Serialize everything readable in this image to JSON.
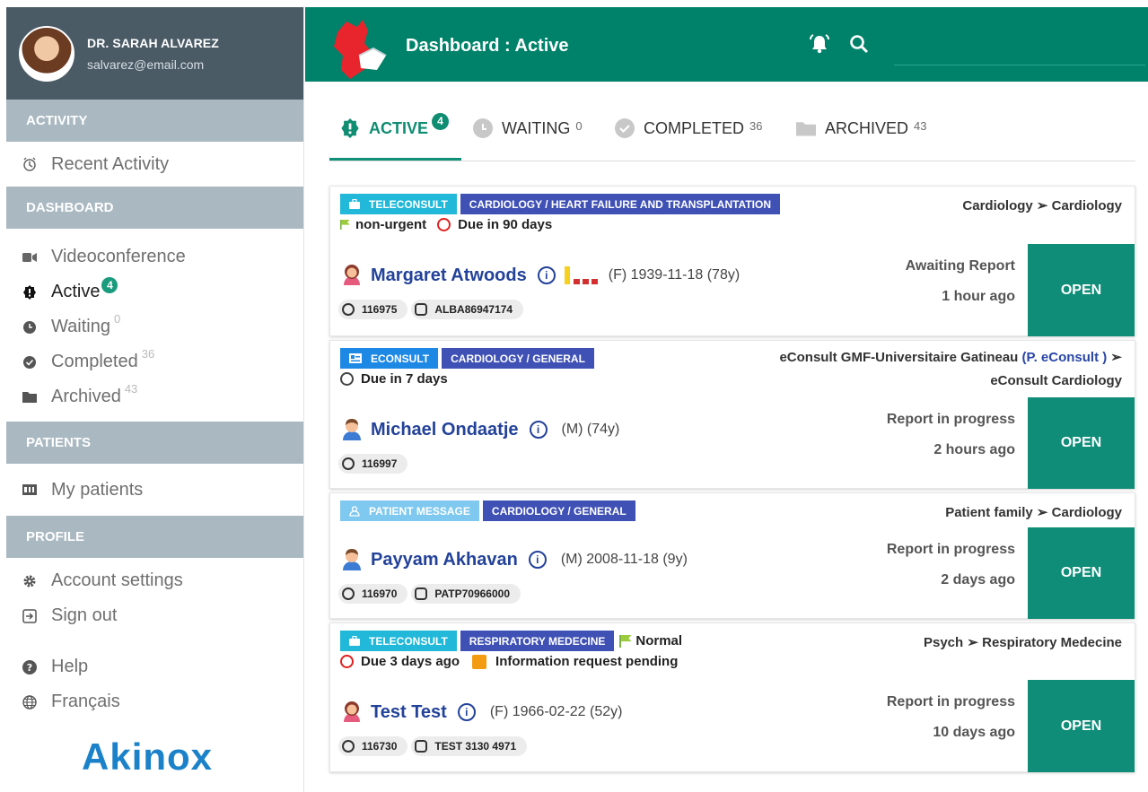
{
  "user": {
    "name": "DR. SARAH ALVAREZ",
    "email": "salvarez@email.com"
  },
  "sidebar": {
    "sections": [
      {
        "title": "ACTIVITY",
        "items": [
          {
            "label": "Recent Activity",
            "icon": "clock-icon"
          }
        ]
      },
      {
        "title": "DASHBOARD",
        "items": [
          {
            "label": "Videoconference",
            "icon": "video-camera-icon"
          },
          {
            "label": "Active",
            "icon": "alert-badge-icon",
            "count": "4"
          },
          {
            "label": "Waiting",
            "icon": "clock-solid-icon",
            "count": "0"
          },
          {
            "label": "Completed",
            "icon": "check-circle-icon",
            "count": "36"
          },
          {
            "label": "Archived",
            "icon": "folder-icon",
            "count": "43"
          }
        ]
      },
      {
        "title": "PATIENTS",
        "items": [
          {
            "label": "My patients",
            "icon": "id-card-icon"
          }
        ]
      },
      {
        "title": "PROFILE",
        "items": [
          {
            "label": "Account settings",
            "icon": "gear-icon"
          },
          {
            "label": "Sign out",
            "icon": "sign-out-icon"
          }
        ]
      }
    ],
    "footer": [
      {
        "label": "Help",
        "icon": "help-icon"
      },
      {
        "label": "Français",
        "icon": "globe-icon"
      }
    ],
    "logo": "Akinox"
  },
  "header": {
    "title": "Dashboard : Active"
  },
  "tabs": [
    {
      "label": "ACTIVE",
      "count": "4"
    },
    {
      "label": "WAITING",
      "count": "0"
    },
    {
      "label": "COMPLETED",
      "count": "36"
    },
    {
      "label": "ARCHIVED",
      "count": "43"
    }
  ],
  "cards": [
    {
      "type": "TELECONSULT",
      "specialty": "CARDIOLOGY / HEART FAILURE AND TRANSPLANTATION",
      "meta_flag": "non-urgent",
      "meta_due": "Due in 90 days",
      "route_from": "Cardiology",
      "route_to": "Cardiology",
      "patient": "Margaret Atwoods",
      "details": "(F) 1939-11-18 (78y)",
      "id1": "116975",
      "id2": "ALBA86947174",
      "status": "Awaiting Report",
      "time": "1 hour ago",
      "open": "OPEN"
    },
    {
      "type": "ECONSULT",
      "specialty": "CARDIOLOGY / GENERAL",
      "meta_due": "Due in 7 days",
      "route_from": "eConsult GMF-Universitaire Gatineau",
      "route_link": "(P. eConsult )",
      "route_to": "eConsult Cardiology",
      "patient": "Michael Ondaatje",
      "details": "(M) (74y)",
      "id1": "116997",
      "status": "Report in progress",
      "time": "2 hours ago",
      "open": "OPEN"
    },
    {
      "type": "PATIENT MESSAGE",
      "specialty": "CARDIOLOGY / GENERAL",
      "route_from": "Patient family",
      "route_to": "Cardiology",
      "patient": "Payyam Akhavan",
      "details": "(M) 2008-11-18 (9y)",
      "id1": "116970",
      "id2": "PATP70966000",
      "status": "Report in progress",
      "time": "2 days ago",
      "open": "OPEN"
    },
    {
      "type": "TELECONSULT",
      "specialty": "RESPIRATORY MEDECINE",
      "tag_flag": "Normal",
      "meta_due": "Due 3 days ago",
      "meta_info": "Information request pending",
      "route_from": "Psych",
      "route_to": "Respiratory Medecine",
      "patient": "Test Test",
      "details": "(F) 1966-02-22 (52y)",
      "id1": "116730",
      "id2": "TEST 3130 4971",
      "status": "Report in progress",
      "time": "10 days ago",
      "open": "OPEN"
    }
  ],
  "colors": {
    "header": "#00826A",
    "sidebar_header": "#A9B8C1",
    "profile": "#4B5B66",
    "open_button": "#0F8D78",
    "tag_blue": "#3F51B5"
  }
}
